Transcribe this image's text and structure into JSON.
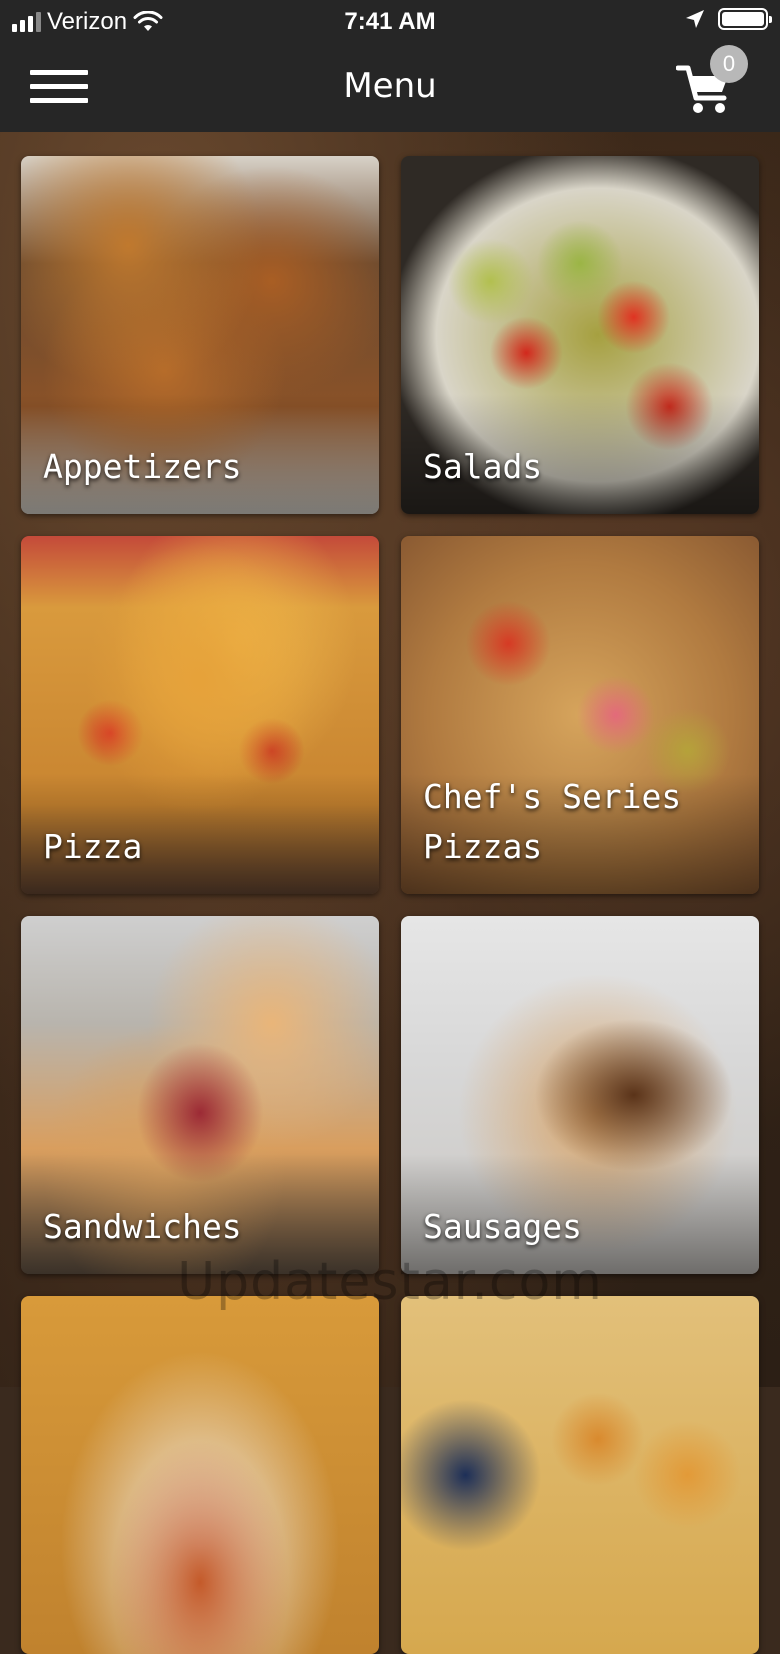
{
  "status_bar": {
    "carrier": "Verizon",
    "time": "7:41 AM"
  },
  "app_bar": {
    "title": "Menu",
    "cart_count": "0"
  },
  "categories": [
    {
      "label": "Appetizers"
    },
    {
      "label": "Salads"
    },
    {
      "label": "Pizza"
    },
    {
      "label": "Chef's Series\nPizzas"
    },
    {
      "label": "Sandwiches"
    },
    {
      "label": "Sausages"
    },
    {
      "label": ""
    },
    {
      "label": ""
    }
  ],
  "watermark": "Updatestar.com",
  "colors": {
    "bar_background": "#262626",
    "badge": "#b8b8b8",
    "text": "#ffffff"
  },
  "icons": {
    "menu": "hamburger-icon",
    "cart": "shopping-cart-icon",
    "signal": "cellular-signal-icon",
    "wifi": "wifi-icon",
    "location": "location-arrow-icon",
    "battery": "battery-icon"
  }
}
